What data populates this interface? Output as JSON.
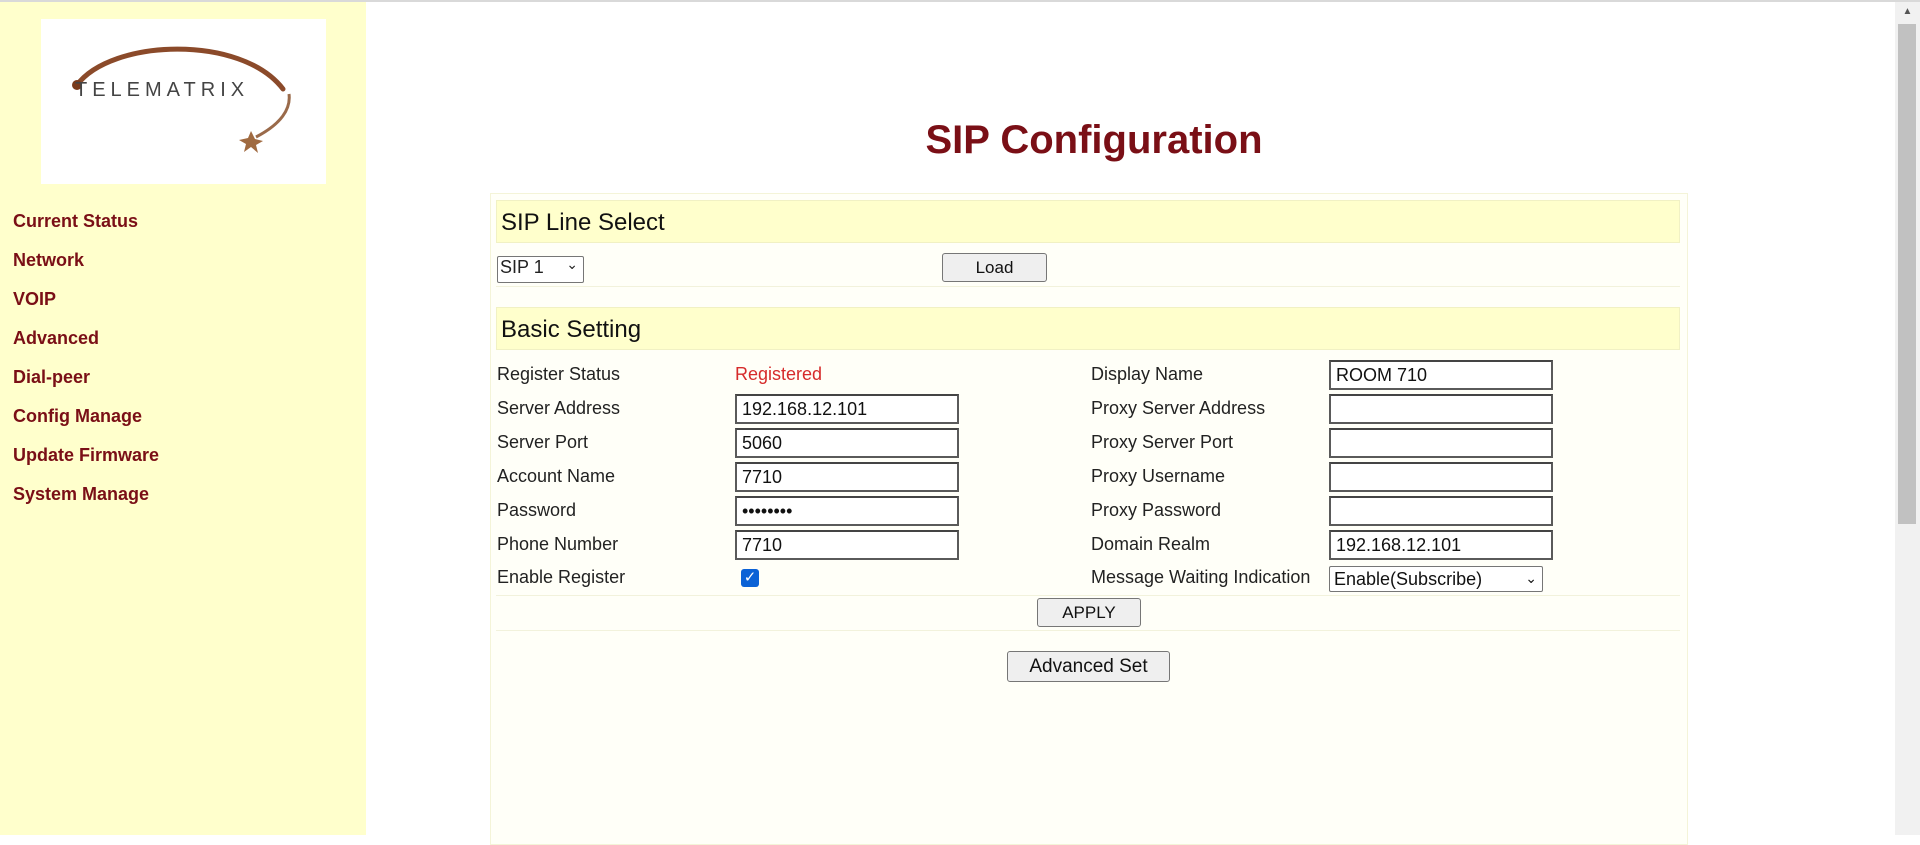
{
  "sidebar": {
    "logo_text": "TELEMATRIX",
    "items": [
      {
        "label": "Current Status"
      },
      {
        "label": "Network"
      },
      {
        "label": "VOIP"
      },
      {
        "label": "Advanced"
      },
      {
        "label": "Dial-peer"
      },
      {
        "label": "Config Manage"
      },
      {
        "label": "Update Firmware"
      },
      {
        "label": "System Manage"
      }
    ]
  },
  "page": {
    "title": "SIP Configuration"
  },
  "line_select": {
    "heading": "SIP Line Select",
    "selected": "SIP 1",
    "load_label": "Load"
  },
  "basic": {
    "heading": "Basic Setting",
    "left": {
      "register_status_label": "Register Status",
      "register_status_value": "Registered",
      "server_address_label": "Server Address",
      "server_address_value": "192.168.12.101",
      "server_port_label": "Server Port",
      "server_port_value": "5060",
      "account_name_label": "Account Name",
      "account_name_value": "7710",
      "password_label": "Password",
      "password_value": "••••••••",
      "phone_number_label": "Phone Number",
      "phone_number_value": "7710",
      "enable_register_label": "Enable Register",
      "enable_register_checked": true
    },
    "right": {
      "display_name_label": "Display Name",
      "display_name_value": "ROOM 710",
      "proxy_server_address_label": "Proxy Server Address",
      "proxy_server_address_value": "",
      "proxy_server_port_label": "Proxy Server Port",
      "proxy_server_port_value": "",
      "proxy_username_label": "Proxy Username",
      "proxy_username_value": "",
      "proxy_password_label": "Proxy Password",
      "proxy_password_value": "",
      "domain_realm_label": "Domain Realm",
      "domain_realm_value": "192.168.12.101",
      "mwi_label": "Message Waiting Indication",
      "mwi_value": "Enable(Subscribe)"
    },
    "apply_label": "APPLY",
    "advanced_set_label": "Advanced Set"
  },
  "colors": {
    "sidebar_bg": "#ffffcc",
    "accent": "#7a0f16",
    "status_registered": "#d62b2b",
    "checkbox": "#0b62d6"
  }
}
